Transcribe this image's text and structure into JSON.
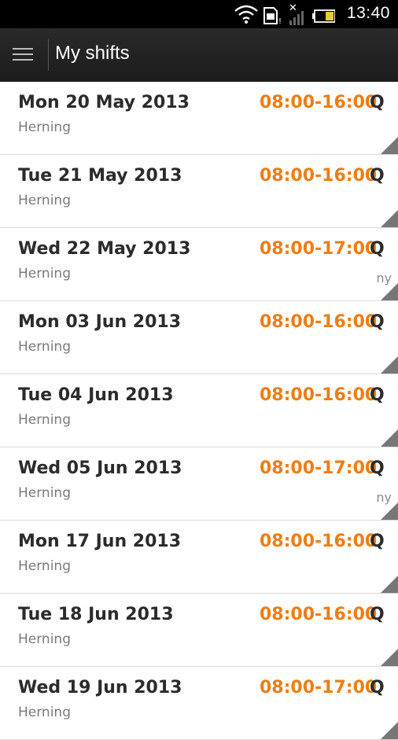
{
  "status_bar": {
    "time": "13:40"
  },
  "header": {
    "title": "My shifts"
  },
  "shifts": [
    {
      "date": "Mon 20 May 2013",
      "time": "08:00-16:00",
      "suffix": "Q",
      "location": "Herning",
      "tag": ""
    },
    {
      "date": "Tue 21 May 2013",
      "time": "08:00-16:00",
      "suffix": "Q",
      "location": "Herning",
      "tag": ""
    },
    {
      "date": "Wed 22 May 2013",
      "time": "08:00-17:00",
      "suffix": "Q",
      "location": "Herning",
      "tag": "ny"
    },
    {
      "date": "Mon 03 Jun 2013",
      "time": "08:00-16:00",
      "suffix": "Q",
      "location": "Herning",
      "tag": ""
    },
    {
      "date": "Tue 04 Jun 2013",
      "time": "08:00-16:00",
      "suffix": "Q",
      "location": "Herning",
      "tag": ""
    },
    {
      "date": "Wed 05 Jun 2013",
      "time": "08:00-17:00",
      "suffix": "Q",
      "location": "Herning",
      "tag": "ny"
    },
    {
      "date": "Mon 17 Jun 2013",
      "time": "08:00-16:00",
      "suffix": "Q",
      "location": "Herning",
      "tag": ""
    },
    {
      "date": "Tue 18 Jun 2013",
      "time": "08:00-16:00",
      "suffix": "Q",
      "location": "Herning",
      "tag": ""
    },
    {
      "date": "Wed 19 Jun 2013",
      "time": "08:00-17:00",
      "suffix": "Q",
      "location": "Herning",
      "tag": ""
    }
  ],
  "colors": {
    "accent": "#ee7d14",
    "action_bar": "#222222"
  },
  "icons": {
    "wifi": "wifi-icon",
    "sd": "sd-card-icon",
    "signal": "signal-icon",
    "battery": "battery-icon",
    "menu": "menu-icon",
    "corner": "corner-triangle-icon"
  }
}
